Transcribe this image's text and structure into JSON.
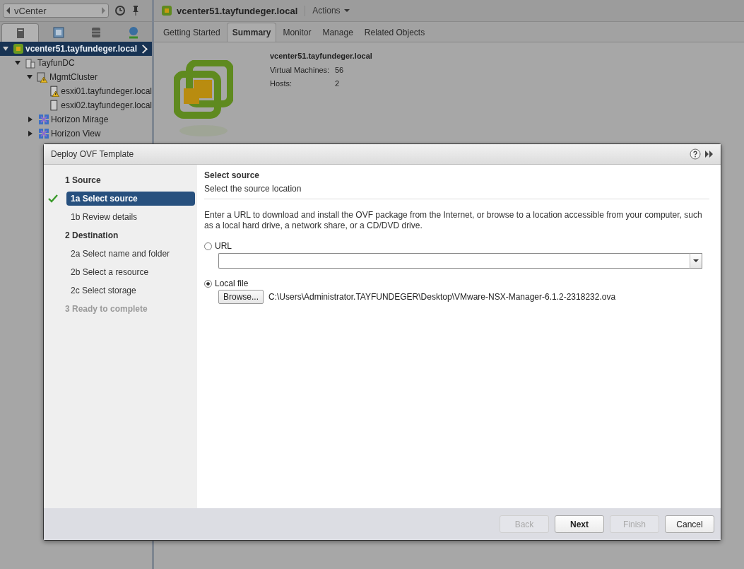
{
  "navigator": {
    "back_label": "vCenter"
  },
  "tree": [
    {
      "label": "vcenter51.tayfundeger.local",
      "kind": "vcenter",
      "selected": true,
      "expanded": true,
      "warning": false,
      "children": [
        {
          "label": "TayfunDC",
          "kind": "datacenter",
          "selected": false,
          "expanded": true,
          "warning": false,
          "children": [
            {
              "label": "MgmtCluster",
              "kind": "cluster",
              "selected": false,
              "expanded": true,
              "warning": true,
              "children": [
                {
                  "label": "esxi01.tayfundeger.local",
                  "kind": "host",
                  "selected": false,
                  "warning": true
                },
                {
                  "label": "esxi02.tayfundeger.local",
                  "kind": "host",
                  "selected": false,
                  "warning": false
                }
              ]
            },
            {
              "label": "Horizon Mirage",
              "kind": "folder",
              "selected": false,
              "expanded": false,
              "warning": false
            },
            {
              "label": "Horizon View",
              "kind": "folder",
              "selected": false,
              "expanded": false,
              "warning": false
            }
          ]
        }
      ]
    }
  ],
  "object_header": {
    "title": "vcenter51.tayfundeger.local",
    "actions": "Actions"
  },
  "tabs": [
    {
      "label": "Getting Started",
      "selected": false
    },
    {
      "label": "Summary",
      "selected": true
    },
    {
      "label": "Monitor",
      "selected": false
    },
    {
      "label": "Manage",
      "selected": false
    },
    {
      "label": "Related Objects",
      "selected": false
    }
  ],
  "summary": {
    "title": "vcenter51.tayfundeger.local",
    "facts": [
      {
        "label": "Virtual Machines:",
        "value": "56"
      },
      {
        "label": "Hosts:",
        "value": "2"
      }
    ]
  },
  "dialog": {
    "title": "Deploy OVF Template",
    "steps": [
      {
        "kind": "group",
        "label": "1  Source",
        "selected": false,
        "done": false,
        "disabled": false
      },
      {
        "kind": "step",
        "label": "1a  Select source",
        "selected": true,
        "done": true,
        "disabled": false
      },
      {
        "kind": "step",
        "label": "1b  Review details",
        "selected": false,
        "done": false,
        "disabled": false
      },
      {
        "kind": "group",
        "label": "2  Destination",
        "selected": false,
        "done": false,
        "disabled": false
      },
      {
        "kind": "step",
        "label": "2a  Select name and folder",
        "selected": false,
        "done": false,
        "disabled": false
      },
      {
        "kind": "step",
        "label": "2b  Select a resource",
        "selected": false,
        "done": false,
        "disabled": false
      },
      {
        "kind": "step",
        "label": "2c  Select storage",
        "selected": false,
        "done": false,
        "disabled": false
      },
      {
        "kind": "group",
        "label": "3  Ready to complete",
        "selected": false,
        "done": false,
        "disabled": true
      }
    ],
    "page_title": "Select source",
    "page_subtitle": "Select the source location",
    "instructions": "Enter a URL to download and install the OVF package from the Internet, or browse to a location accessible from your computer, such as a local hard drive, a network share, or a CD/DVD drive.",
    "options": [
      {
        "kind": "url",
        "label": "URL",
        "selected": false
      },
      {
        "kind": "file",
        "label": "Local file",
        "selected": true,
        "button": "Browse...",
        "path": "C:\\Users\\Administrator.TAYFUNDEGER\\Desktop\\VMware-NSX-Manager-6.1.2-2318232.ova"
      }
    ],
    "buttons": [
      {
        "label": "Back",
        "disabled": true,
        "primary": false
      },
      {
        "label": "Next",
        "disabled": false,
        "primary": true
      },
      {
        "label": "Finish",
        "disabled": true,
        "primary": false
      },
      {
        "label": "Cancel",
        "disabled": false,
        "primary": false
      }
    ]
  }
}
